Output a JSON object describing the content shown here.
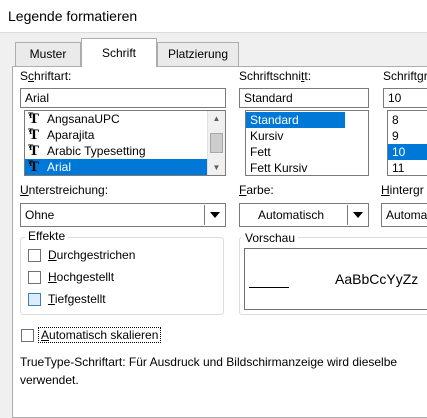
{
  "window": {
    "title": "Legende formatieren"
  },
  "tabs": [
    {
      "label": "Muster"
    },
    {
      "label": "Schrift",
      "active": true
    },
    {
      "label": "Platzierung"
    }
  ],
  "font": {
    "label": "Schriftart:",
    "value": "Arial",
    "items": [
      "AngsanaUPC",
      "Aparajita",
      "Arabic Typesetting",
      "Arial"
    ],
    "selected_index": 3
  },
  "style": {
    "label": "Schriftschnitt:",
    "value": "Standard",
    "items": [
      "Standard",
      "Kursiv",
      "Fett",
      "Fett Kursiv"
    ],
    "selected_index": 0
  },
  "size": {
    "label": "Schriftgr",
    "value": "10",
    "items": [
      "8",
      "9",
      "10",
      "11"
    ],
    "selected_index": 2
  },
  "underline": {
    "label": "Unterstreichung:",
    "value": "Ohne"
  },
  "color": {
    "label": "Farbe:",
    "value": "Automatisch"
  },
  "background": {
    "label": "Hintergr",
    "value": "Automa"
  },
  "effects": {
    "label": "Effekte",
    "items": [
      {
        "label": "Durchgestrichen",
        "checked": false
      },
      {
        "label": "Hochgestellt",
        "checked": false
      },
      {
        "label": "Tiefgestellt",
        "checked": false
      }
    ]
  },
  "preview": {
    "label": "Vorschau",
    "sample": "AaBbCcYyZz"
  },
  "autoscale": {
    "label": "Automatisch skalieren",
    "checked": false
  },
  "info": {
    "line1": "TrueType-Schriftart: Für Ausdruck und Bildschirmanzeige wird dieselbe",
    "line2": "verwendet."
  },
  "colors": {
    "selection": "#0078d7",
    "panel": "#ffffff",
    "chrome": "#f0f0f0"
  }
}
